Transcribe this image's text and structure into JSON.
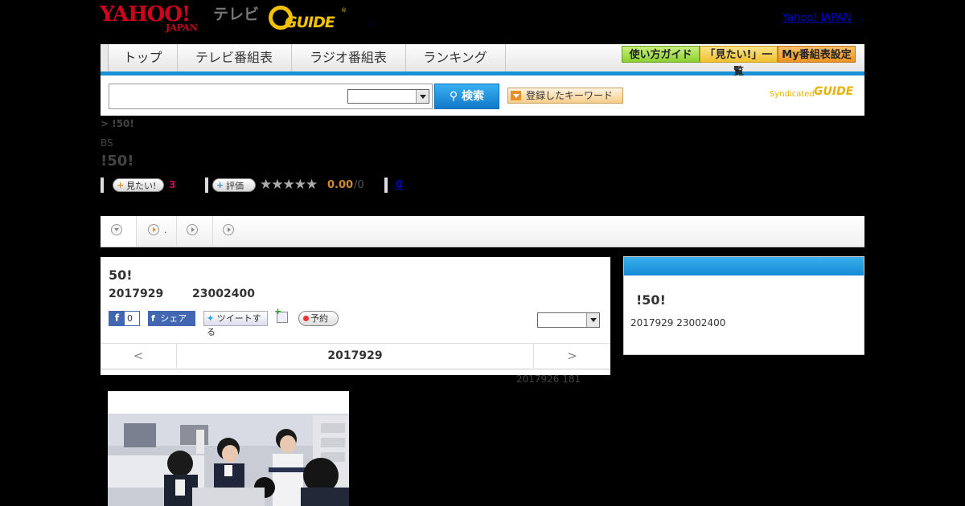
{
  "header": {
    "logo_yahoo": "YAHOO!",
    "logo_japan": "JAPAN",
    "logo_tv": "テレビ",
    "logo_gguide": "GUIDE",
    "yahoo_japan_link": "Yahoo! JAPAN",
    "link_suffix": "."
  },
  "nav": {
    "tabs": [
      "トップ",
      "テレビ番組表",
      "ラジオ番組表",
      "ランキング"
    ],
    "buttons": [
      "使い方ガイド",
      "「見たい!」一覧",
      "My番組表設定"
    ],
    "button_colors": [
      "#9fd84a",
      "#f5c842",
      "#f2a030"
    ]
  },
  "search": {
    "button_label": "検索",
    "keyword_label": "登録したキーワード",
    "syndicated": "Syndicated",
    "syndicated_logo": "GUIDE"
  },
  "program": {
    "breadcrumb": "> !50!",
    "channel": "BS",
    "title": "!50!",
    "wanna_label": "見たい!",
    "wanna_count": "3",
    "rate_label": "評価",
    "stars": "★★★★★",
    "rating": "0.00",
    "rating_count": "/0",
    "review_count": "0"
  },
  "tabs": {
    "second_label": "."
  },
  "episode": {
    "title": "50!",
    "date": "2017929",
    "time": "23002400",
    "fb_like_count": "0",
    "fb_share": "シェア",
    "tweet": "ツイートする",
    "reserve": "予約",
    "prev": "<",
    "next": ">",
    "nav_date": "2017929",
    "update_info": "2017926  181"
  },
  "side": {
    "title": "!50!",
    "date_time": "2017929  23002400"
  }
}
